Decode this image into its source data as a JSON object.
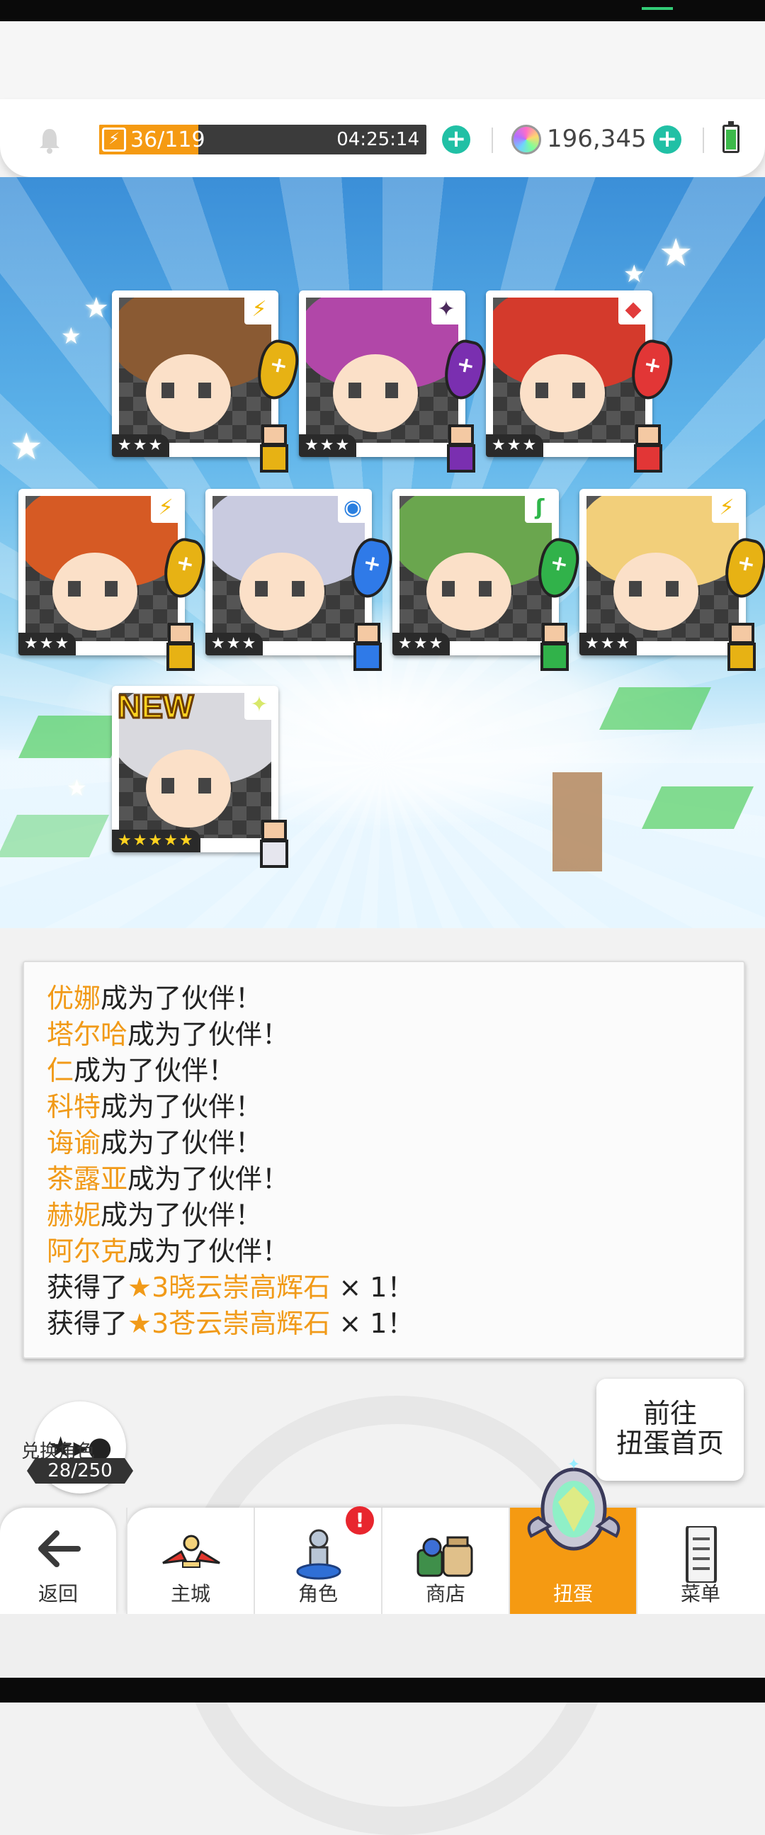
{
  "topbar": {
    "energy_text": "36/119",
    "energy_fraction": 0.3025,
    "energy_timer": "04:25:14",
    "gems": "196,345"
  },
  "cards": [
    {
      "rarity": "★★★",
      "attr": "⚡",
      "attr_color": "#f2b705",
      "hair": "#8a5a33",
      "crystal": "#e7b214",
      "is_new": false
    },
    {
      "rarity": "★★★",
      "attr": "✦",
      "attr_color": "#4b2a5c",
      "hair": "#b147a8",
      "crystal": "#7a2fb0",
      "is_new": false
    },
    {
      "rarity": "★★★",
      "attr": "◆",
      "attr_color": "#e13b3b",
      "hair": "#d43a2c",
      "crystal": "#e23636",
      "is_new": false
    },
    {
      "rarity": "★★★",
      "attr": "⚡",
      "attr_color": "#f2b705",
      "hair": "#d65a24",
      "crystal": "#e7b214",
      "is_new": false
    },
    {
      "rarity": "★★★",
      "attr": "◉",
      "attr_color": "#2a7fe0",
      "hair": "#c9cbe0",
      "crystal": "#2f7ae8",
      "is_new": false
    },
    {
      "rarity": "★★★",
      "attr": "ʃ",
      "attr_color": "#2fb64a",
      "hair": "#6aa64e",
      "crystal": "#31b24a",
      "is_new": false
    },
    {
      "rarity": "★★★",
      "attr": "⚡",
      "attr_color": "#f2b705",
      "hair": "#f2cf7a",
      "crystal": "#e7b214",
      "is_new": false
    },
    {
      "rarity": "★★★★★",
      "attr": "✦",
      "attr_color": "#d8e86a",
      "hair": "#d9d9de",
      "crystal": "",
      "is_new": true,
      "new_label": "NEW"
    }
  ],
  "log": [
    {
      "name": "优娜",
      "text": "成为了伙伴！"
    },
    {
      "name": "塔尔哈",
      "text": "成为了伙伴！"
    },
    {
      "name": "仁",
      "text": "成为了伙伴！"
    },
    {
      "name": "科特",
      "text": "成为了伙伴！"
    },
    {
      "name": "诲谕",
      "text": "成为了伙伴！"
    },
    {
      "name": "茶露亚",
      "text": "成为了伙伴！"
    },
    {
      "name": "赫妮",
      "text": "成为了伙伴！"
    },
    {
      "name": "阿尔克",
      "text": "成为了伙伴！"
    },
    {
      "prefix": "获得了",
      "item": "★3晓云崇高辉石",
      "suffix": " × 1！"
    },
    {
      "prefix": "获得了",
      "item": "★3苍云崇高辉石",
      "suffix": " × 1！"
    }
  ],
  "exchange": {
    "label": "兑换角色",
    "count": "28/250"
  },
  "goto_button": {
    "line1": "前往",
    "line2": "扭蛋首页"
  },
  "nav": {
    "back": "返回",
    "tabs": [
      {
        "label": "主城",
        "icon": "castle-icon"
      },
      {
        "label": "角色",
        "icon": "character-icon",
        "alert": "!"
      },
      {
        "label": "商店",
        "icon": "shop-icon"
      },
      {
        "label": "扭蛋",
        "icon": "gacha-icon",
        "active": true
      },
      {
        "label": "菜单",
        "icon": "menu-icon"
      }
    ]
  }
}
